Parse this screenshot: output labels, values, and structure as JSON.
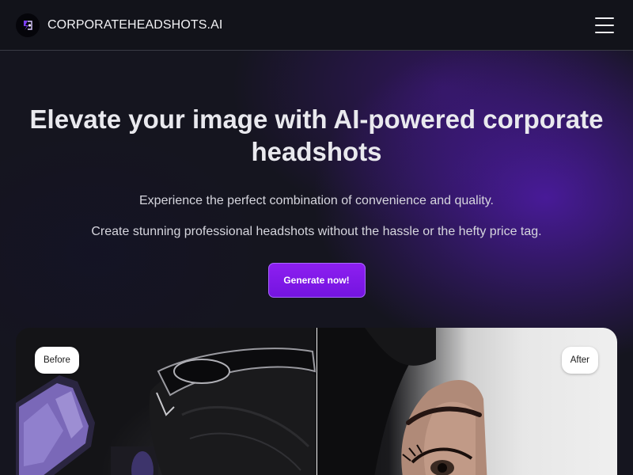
{
  "header": {
    "brand": "CORPORATEHEADSHOTS.AI",
    "logo_icon": "logo-icon",
    "menu_icon": "hamburger-menu-icon"
  },
  "hero": {
    "title": "Elevate your image with AI-powered corporate headshots",
    "subtitle_1": "Experience the perfect combination of convenience and quality.",
    "subtitle_2": "Create stunning professional headshots without the hassle or the hefty price tag.",
    "cta_label": "Generate now!"
  },
  "comparison": {
    "before_label": "Before",
    "after_label": "After"
  },
  "colors": {
    "accent": "#8d1ff0",
    "background": "#15151f",
    "header_bg": "#12131a"
  }
}
